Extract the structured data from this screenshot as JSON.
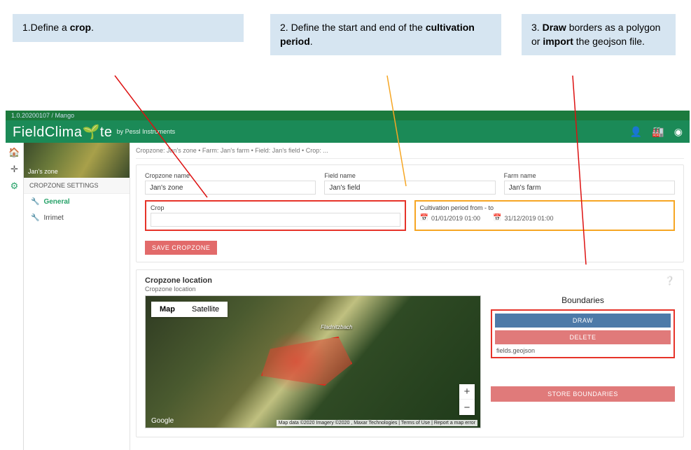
{
  "annotations": {
    "a1_pre": "1.Define a ",
    "a1_b": "crop",
    "a1_post": ".",
    "a2_pre": "2. Define the start and end of the ",
    "a2_b": "cultivation period",
    "a2_post": ".",
    "a3_pre": "3. ",
    "a3_b1": "Draw",
    "a3_mid": " borders as a polygon or ",
    "a3_b2": "import",
    "a3_post": " the geojson file."
  },
  "app": {
    "version": "1.0.20200107 / Mango",
    "brand": "FieldClima",
    "brand_suffix": "te",
    "brand_sub": "by Pessl Instruments",
    "breadcrumb": "Cropzone: Jan's zone • Farm: Jan's farm • Field: Jan's field • Crop: ..."
  },
  "sidebar": {
    "hero": "Jan's zone",
    "section": "CROPZONE SETTINGS",
    "items": [
      {
        "icon": "🔧",
        "label": "General"
      },
      {
        "icon": "🔧",
        "label": "Irrimet"
      }
    ]
  },
  "form": {
    "cropzone_label": "Cropzone name",
    "cropzone_value": "Jan's zone",
    "field_label": "Field name",
    "field_value": "Jan's field",
    "farm_label": "Farm name",
    "farm_value": "Jan's farm",
    "crop_label": "Crop",
    "cult_label": "Cultivation period from - to",
    "cult_from": "01/01/2019 01:00",
    "cult_to": "31/12/2019 01:00",
    "save": "SAVE CROPZONE"
  },
  "location": {
    "title": "Cropzone location",
    "sub": "Cropzone location",
    "map_tab": "Map",
    "sat_tab": "Satellite",
    "road_label": "Fladnitzbach",
    "attr": "Google",
    "attr2": "Map data ©2020 Imagery ©2020 , Maxar Technologies | Terms of Use | Report a map error"
  },
  "boundaries": {
    "title": "Boundaries",
    "draw": "DRAW",
    "delete": "DELETE",
    "file": "fields.geojson",
    "store": "STORE BOUNDARIES"
  },
  "colors": {
    "accent": "#1b8a57",
    "danger": "#e07a7a",
    "draw": "#4d7aa8",
    "highlight_red": "#e63329",
    "highlight_orange": "#f6a623"
  }
}
